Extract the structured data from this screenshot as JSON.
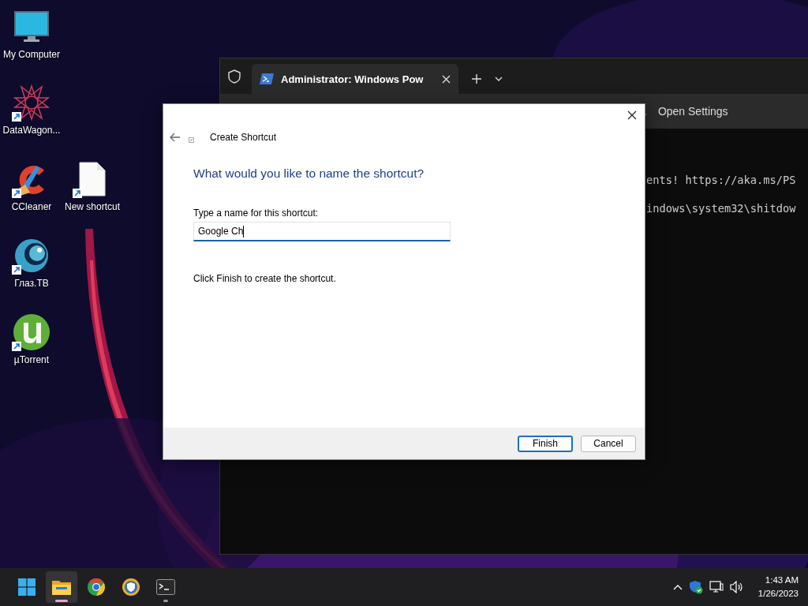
{
  "desktop_icons": [
    {
      "kind": "monitor",
      "label": "My Computer",
      "shortcut": false
    },
    {
      "kind": "star",
      "label": "DataWagon...",
      "shortcut": true
    },
    {
      "kind": "ccleaner",
      "label": "CCleaner",
      "shortcut": true
    },
    {
      "kind": "document",
      "label": "New shortcut",
      "shortcut": true
    },
    {
      "kind": "eye",
      "label": "Глаз.ТВ",
      "shortcut": true
    },
    {
      "kind": "torrent",
      "label": "µTorrent",
      "shortcut": true
    }
  ],
  "terminal": {
    "tab_title": "Administrator: Windows Pow",
    "message_bar": {
      "ellipsis": ".",
      "action": "Open Settings"
    },
    "lines": [
      "ents! https://aka.ms/PS",
      "indows\\system32\\shitdow"
    ]
  },
  "dialog": {
    "title": "Create Shortcut",
    "heading": "What would you like to name the shortcut?",
    "field_label": "Type a name for this shortcut:",
    "field_value": "Google Ch",
    "focused": true,
    "instruction": "Click Finish to create the shortcut.",
    "buttons": [
      {
        "label": "Finish",
        "default": true
      },
      {
        "label": "Cancel",
        "default": false
      }
    ]
  },
  "taskbar": {
    "apps": [
      {
        "kind": "explorer",
        "running": true,
        "focused": true
      },
      {
        "kind": "chrome",
        "running": false,
        "focused": false
      },
      {
        "kind": "shield-browser",
        "running": false,
        "focused": false
      },
      {
        "kind": "terminal",
        "running": true,
        "focused": false
      }
    ],
    "time": "1:43 AM",
    "date": "1/26/2023"
  }
}
